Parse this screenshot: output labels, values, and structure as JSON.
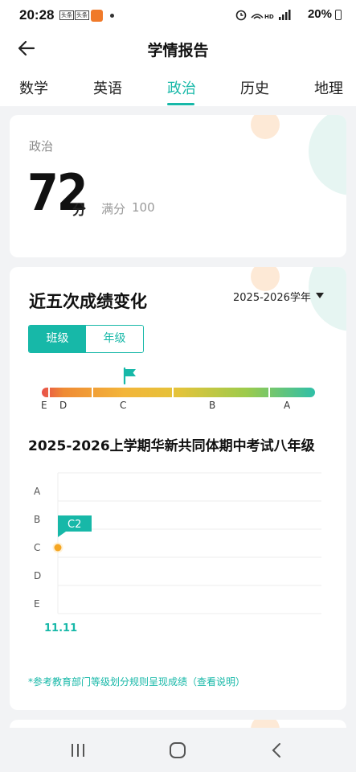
{
  "status_bar": {
    "time": "20:28",
    "app_chip_1": "头条",
    "app_chip_2": "头条",
    "battery": "20%"
  },
  "header": {
    "title": "学情报告"
  },
  "tabs": [
    {
      "label": "数学",
      "active": false
    },
    {
      "label": "英语",
      "active": false
    },
    {
      "label": "政治",
      "active": true
    },
    {
      "label": "历史",
      "active": false
    },
    {
      "label": "地理",
      "active": false
    }
  ],
  "score_card": {
    "subject": "政治",
    "score": "72",
    "unit": "分",
    "full_label": "满分",
    "full_value": "100"
  },
  "trend_card": {
    "title": "近五次成绩变化",
    "year": "2025-2026学年",
    "toggle": {
      "class_label": "班级",
      "grade_label": "年级",
      "selected": "班级"
    },
    "grade_scale": [
      "E",
      "D",
      "C",
      "B",
      "A"
    ],
    "current_marker": "C",
    "exam_title": "2025-2026上学期华新共同体期中考试八年级",
    "footnote_prefix": "*参考教育部门等级划分规则呈现成绩",
    "footnote_link": "（查看说明）"
  },
  "chart_data": {
    "type": "line",
    "x": [
      "11.11"
    ],
    "y_categories": [
      "A",
      "B",
      "C",
      "D",
      "E"
    ],
    "series": [
      {
        "values": [
          "C"
        ],
        "point_labels": [
          "C2"
        ]
      }
    ]
  },
  "colors": {
    "accent": "#17b8a8",
    "point": "#f5a623"
  },
  "icons": {
    "back": "arrow-left-icon",
    "flag": "flag-icon",
    "dropdown": "caret-down-icon",
    "nav_recent": "recent-apps-icon",
    "nav_home": "home-icon",
    "nav_back": "nav-back-icon"
  }
}
